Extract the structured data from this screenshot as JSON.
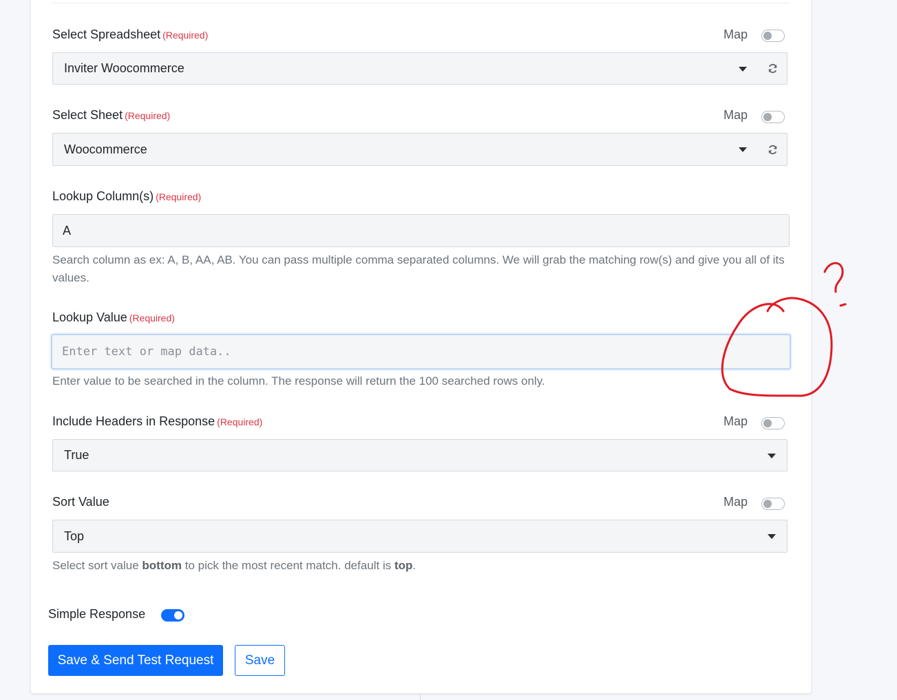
{
  "form": {
    "spreadsheet": {
      "label": "Select Spreadsheet",
      "required": "(Required)",
      "map_label": "Map",
      "value": "Inviter Woocommerce"
    },
    "sheet": {
      "label": "Select Sheet",
      "required": "(Required)",
      "map_label": "Map",
      "value": "Woocommerce"
    },
    "lookup_columns": {
      "label": "Lookup Column(s)",
      "required": "(Required)",
      "value": "A",
      "help": "Search column as ex: A, B, AA, AB. You can pass multiple comma separated columns. We will grab the matching row(s) and give you all of its values."
    },
    "lookup_value": {
      "label": "Lookup Value",
      "required": "(Required)",
      "placeholder": "Enter text or map data..",
      "help": "Enter value to be searched in the column. The response will return the 100 searched rows only."
    },
    "include_headers": {
      "label": "Include Headers in Response",
      "required": "(Required)",
      "map_label": "Map",
      "value": "True"
    },
    "sort_value": {
      "label": "Sort Value",
      "map_label": "Map",
      "value": "Top",
      "help_prefix": "Select sort value ",
      "help_bold1": "bottom",
      "help_middle": " to pick the most recent match. default is ",
      "help_bold2": "top",
      "help_suffix": "."
    },
    "simple_response": {
      "label": "Simple Response",
      "enabled": true
    }
  },
  "actions": {
    "save_send_label": "Save & Send Test Request",
    "save_label": "Save"
  },
  "annotation": {
    "color": "#e01b24",
    "mark": "question-mark"
  }
}
